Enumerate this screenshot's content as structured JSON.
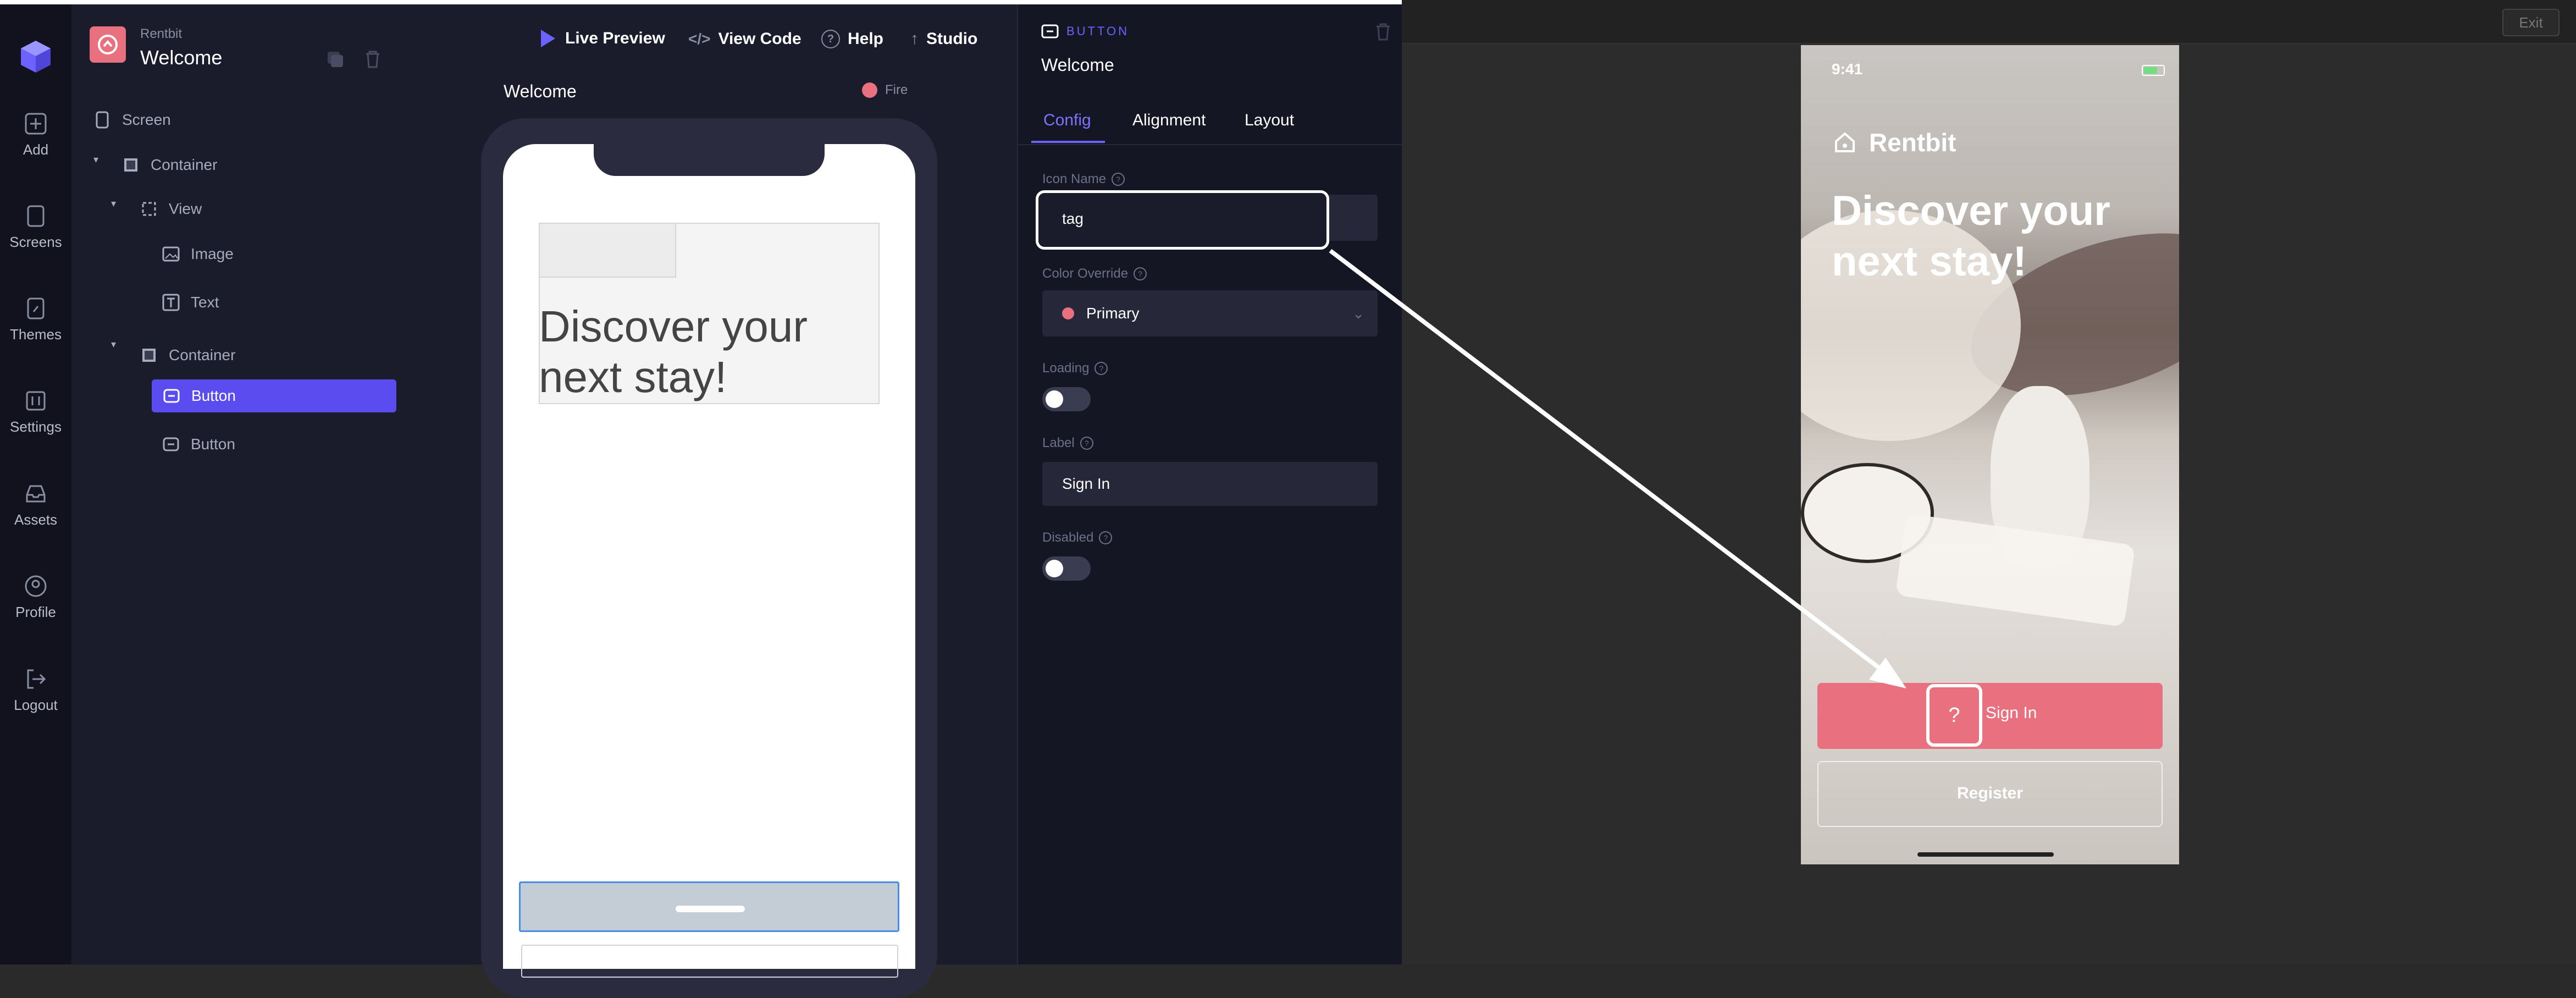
{
  "app": {
    "project_name": "Rentbit",
    "screen_name": "Welcome",
    "colors": {
      "accent": "#5b4cf0",
      "brand": "#e9707e",
      "bg": "#1b1c2b"
    }
  },
  "rail": {
    "items": [
      {
        "label": "Add",
        "icon": "plus-icon"
      },
      {
        "label": "Screens",
        "icon": "screens-icon"
      },
      {
        "label": "Themes",
        "icon": "brush-icon"
      },
      {
        "label": "Settings",
        "icon": "settings-icon"
      },
      {
        "label": "Assets",
        "icon": "inbox-icon"
      },
      {
        "label": "Profile",
        "icon": "profile-icon"
      },
      {
        "label": "Logout",
        "icon": "logout-icon"
      }
    ]
  },
  "tree": {
    "items": [
      {
        "label": "Screen",
        "icon": "phone-icon"
      },
      {
        "label": "Container",
        "icon": "container-icon"
      },
      {
        "label": "View",
        "icon": "view-icon"
      },
      {
        "label": "Image",
        "icon": "image-icon"
      },
      {
        "label": "Text",
        "icon": "text-icon"
      },
      {
        "label": "Container",
        "icon": "container-icon"
      },
      {
        "label": "Button",
        "icon": "button-icon"
      },
      {
        "label": "Button",
        "icon": "button-icon"
      }
    ]
  },
  "toolbar": {
    "live_preview": "Live Preview",
    "view_code": "View Code",
    "help": "Help",
    "studio": "Studio"
  },
  "canvas": {
    "screen_title": "Welcome",
    "device_label": "Fire",
    "heading": "Discover your next stay!"
  },
  "inspector": {
    "kind": "BUTTON",
    "name": "Welcome",
    "tabs": [
      "Config",
      "Alignment",
      "Layout"
    ],
    "active_tab": "Config",
    "icon_name_label": "Icon Name",
    "icon_name_value": "tag",
    "color_override_label": "Color Override",
    "color_override_value": "Primary",
    "loading_label": "Loading",
    "label_label": "Label",
    "label_value": "Sign In",
    "disabled_label": "Disabled"
  },
  "preview": {
    "exit_label": "Exit",
    "time": "9:41",
    "brand": "Rentbit",
    "heading": "Discover your next stay!",
    "signin": "Sign In",
    "signin_icon": "?",
    "register": "Register"
  }
}
